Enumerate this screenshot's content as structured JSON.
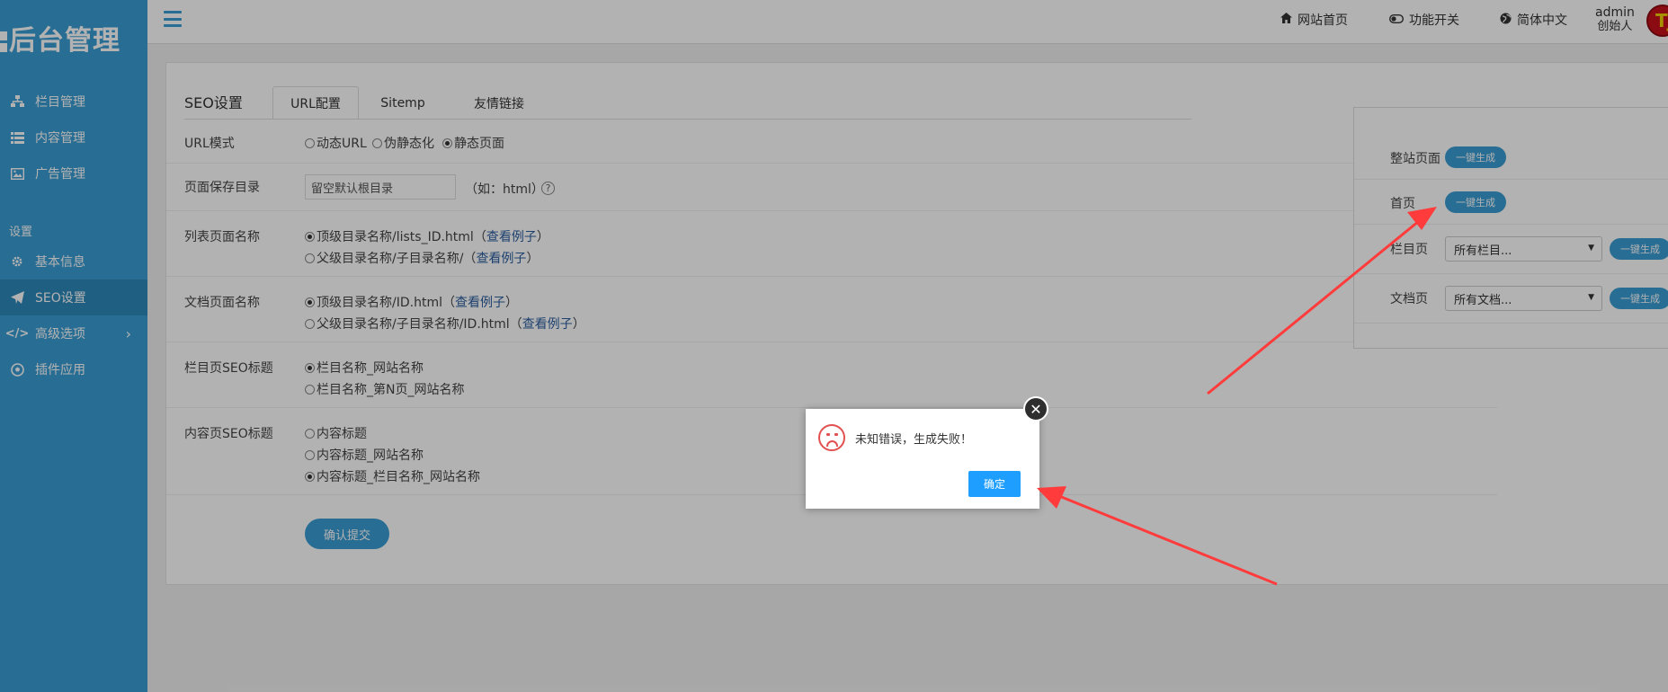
{
  "brand": {
    "logo_text": "后台管理"
  },
  "sidebar": {
    "items": [
      {
        "label": "栏目管理",
        "icon": "sitemap-icon"
      },
      {
        "label": "内容管理",
        "icon": "list-icon"
      },
      {
        "label": "广告管理",
        "icon": "image-icon"
      },
      {
        "label": "基本信息",
        "icon": "gear-icon"
      },
      {
        "label": "SEO设置",
        "icon": "paper-plane-icon"
      },
      {
        "label": "高级选项",
        "icon": "code-icon"
      },
      {
        "label": "插件应用",
        "icon": "soccer-ball-icon"
      }
    ],
    "section_label": "设置",
    "active": "SEO设置"
  },
  "header": {
    "links": [
      {
        "label": "网站首页",
        "icon": "home-icon"
      },
      {
        "label": "功能开关",
        "icon": "toggle-icon"
      },
      {
        "label": "简体中文",
        "icon": "globe-icon"
      }
    ],
    "user": {
      "name": "admin",
      "role": "创始人",
      "avatar_text": "TJ"
    }
  },
  "panel": {
    "title": "SEO设置",
    "tabs": [
      "URL配置",
      "Sitemp",
      "友情链接"
    ],
    "active_tab": "URL配置",
    "url_mode": {
      "label": "URL模式",
      "options": [
        "动态URL",
        "伪静态化",
        "静态页面"
      ],
      "selected": "静态页面"
    },
    "save_dir": {
      "label": "页面保存目录",
      "value": "留空默认根目录",
      "hint": "（如：html）",
      "help": "?"
    },
    "list_page": {
      "label": "列表页面名称",
      "options": [
        {
          "text": "顶级目录名称/lists_ID.html（",
          "link": "查看例子",
          "tail": "）"
        },
        {
          "text": "父级目录名称/子目录名称/（",
          "link": "查看例子",
          "tail": "）"
        }
      ],
      "selected_index": 0
    },
    "doc_page": {
      "label": "文档页面名称",
      "options": [
        {
          "text": "顶级目录名称/ID.html（",
          "link": "查看例子",
          "tail": "）"
        },
        {
          "text": "父级目录名称/子目录名称/ID.html（",
          "link": "查看例子",
          "tail": "）"
        }
      ],
      "selected_index": 0
    },
    "cat_seo": {
      "label": "栏目页SEO标题",
      "options": [
        "栏目名称_网站名称",
        "栏目名称_第N页_网站名称"
      ],
      "selected_index": 0
    },
    "content_seo": {
      "label": "内容页SEO标题",
      "options": [
        "内容标题",
        "内容标题_网站名称",
        "内容标题_栏目名称_网站名称"
      ],
      "selected_index": 2
    },
    "submit_label": "确认提交"
  },
  "generate": {
    "rows": [
      {
        "label": "整站页面",
        "button": "一键生成"
      },
      {
        "label": "首页",
        "button": "一键生成"
      },
      {
        "label": "栏目页",
        "select": "所有栏目...",
        "button": "一键生成"
      },
      {
        "label": "文档页",
        "select": "所有文档...",
        "button": "一键生成"
      }
    ]
  },
  "dialog": {
    "message": "未知错误，生成失败！",
    "ok_label": "确定",
    "close": "✕"
  },
  "colors": {
    "sidebar": "#3a9cd3",
    "sidebar_active": "#2d88ba",
    "primary_button": "#1e9fff",
    "arrow": "#ff3b3b",
    "error": "#e25050"
  }
}
